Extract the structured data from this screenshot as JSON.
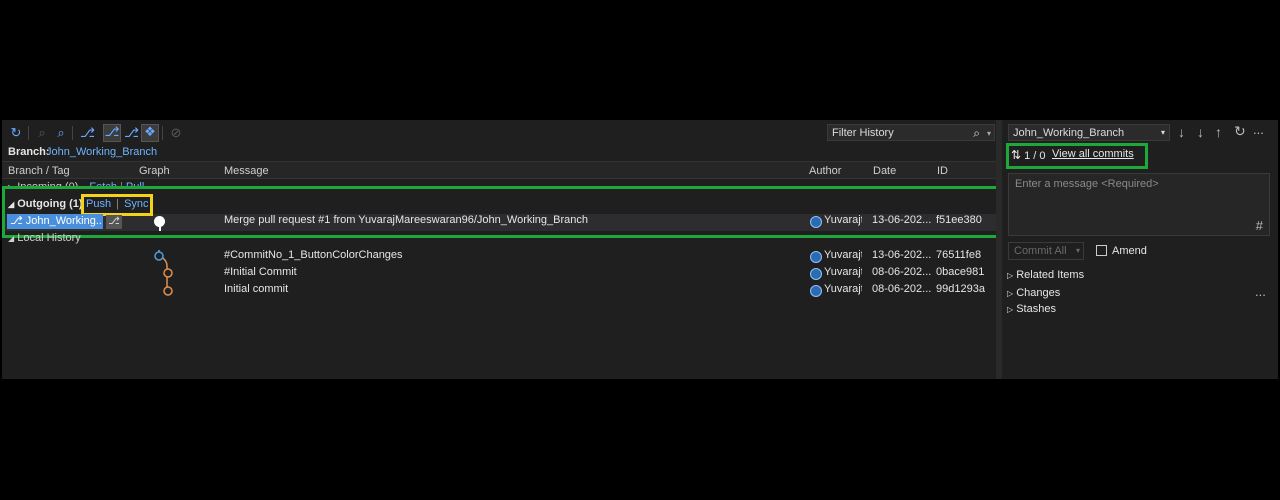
{
  "toolbar": {
    "icons": [
      "refresh-icon",
      "zoom-out-icon",
      "zoom-in-icon",
      "branch-icon",
      "toggle-branches-icon",
      "remote-branches-icon",
      "tag-icon",
      "hide-icon"
    ]
  },
  "branch": {
    "label": "Branch:",
    "name": "John_Working_Branch"
  },
  "filter": {
    "placeholder": "Filter History"
  },
  "columns": {
    "branch_tag": "Branch / Tag",
    "graph": "Graph",
    "message": "Message",
    "author": "Author",
    "date": "Date",
    "id": "ID"
  },
  "incoming": {
    "label": "Incoming (0)",
    "fetch": "Fetch",
    "pull": "Pull"
  },
  "outgoing": {
    "label": "Outgoing (1)",
    "push": "Push",
    "sync": "Sync",
    "sep": "|",
    "commit": {
      "branch_chip": "John_Working...",
      "message": "Merge pull request #1 from YuvarajMareeswaran96/John_Working_Branch",
      "author": "Yuvarajt",
      "date": "13-06-202...",
      "id": "f51ee380"
    }
  },
  "local_history": {
    "label": "Local History",
    "commits": [
      {
        "message": "#CommitNo_1_ButtonColorChanges",
        "author": "Yuvarajt",
        "date": "13-06-202...",
        "id": "76511fe8"
      },
      {
        "message": "#Initial Commit",
        "author": "Yuvarajt",
        "date": "08-06-202...",
        "id": "0bace981"
      },
      {
        "message": "Initial commit",
        "author": "Yuvarajt",
        "date": "08-06-202...",
        "id": "99d1293a"
      }
    ]
  },
  "right_panel": {
    "branch_select": "John_Working_Branch",
    "counts": "1 / 0",
    "view_all": "View all commits",
    "message_placeholder": "Enter a message <Required>",
    "commit_all": "Commit All",
    "amend": "Amend",
    "sections": [
      "Related Items",
      "Changes",
      "Stashes"
    ],
    "more": "..."
  },
  "colors": {
    "highlight_green": "#1fa83a",
    "highlight_yellow": "#f2d21b",
    "link_blue": "#6fb3ff",
    "chip_blue": "#4a8fdc"
  }
}
